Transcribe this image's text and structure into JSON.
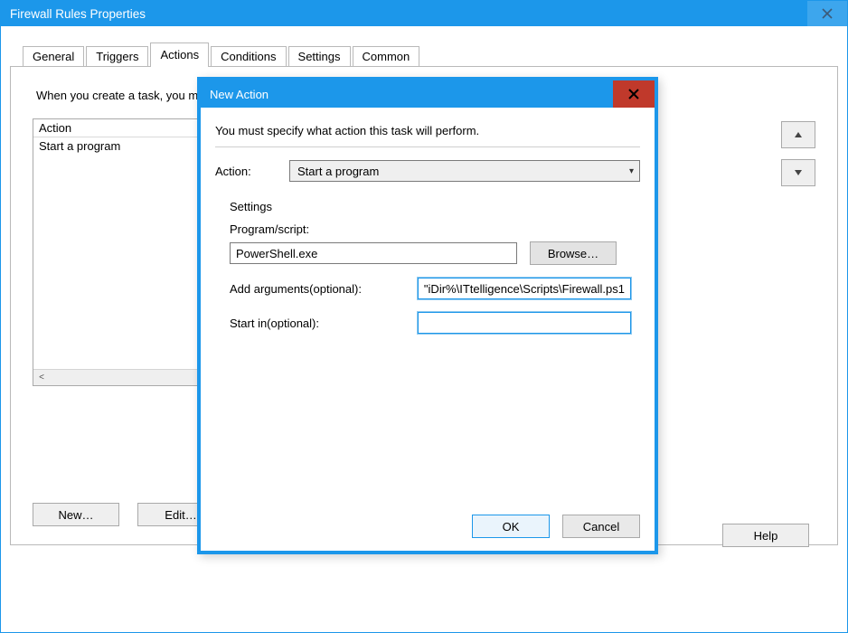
{
  "parent": {
    "title": "Firewall Rules Properties",
    "tabs": [
      "General",
      "Triggers",
      "Actions",
      "Conditions",
      "Settings",
      "Common"
    ],
    "active_tab_index": 2,
    "actions_panel": {
      "intro": "When you create a task, you must specify the action that will occur when your task starts.",
      "col_header": "Action",
      "rows": [
        "Start a program"
      ],
      "buttons": {
        "new": "New…",
        "edit": "Edit…"
      }
    },
    "help_label": "Help"
  },
  "modal": {
    "title": "New Action",
    "instruction": "You must specify what action this task will perform.",
    "action_label": "Action:",
    "action_selected": "Start a program",
    "settings_title": "Settings",
    "program_label": "Program/script:",
    "program_value": "PowerShell.exe",
    "browse_label": "Browse…",
    "args_label": "Add arguments(optional):",
    "args_value": "iDir%\\ITtelligence\\Scripts\\Firewall.ps1\"",
    "startin_label": "Start in(optional):",
    "startin_value": "",
    "ok_label": "OK",
    "cancel_label": "Cancel"
  }
}
